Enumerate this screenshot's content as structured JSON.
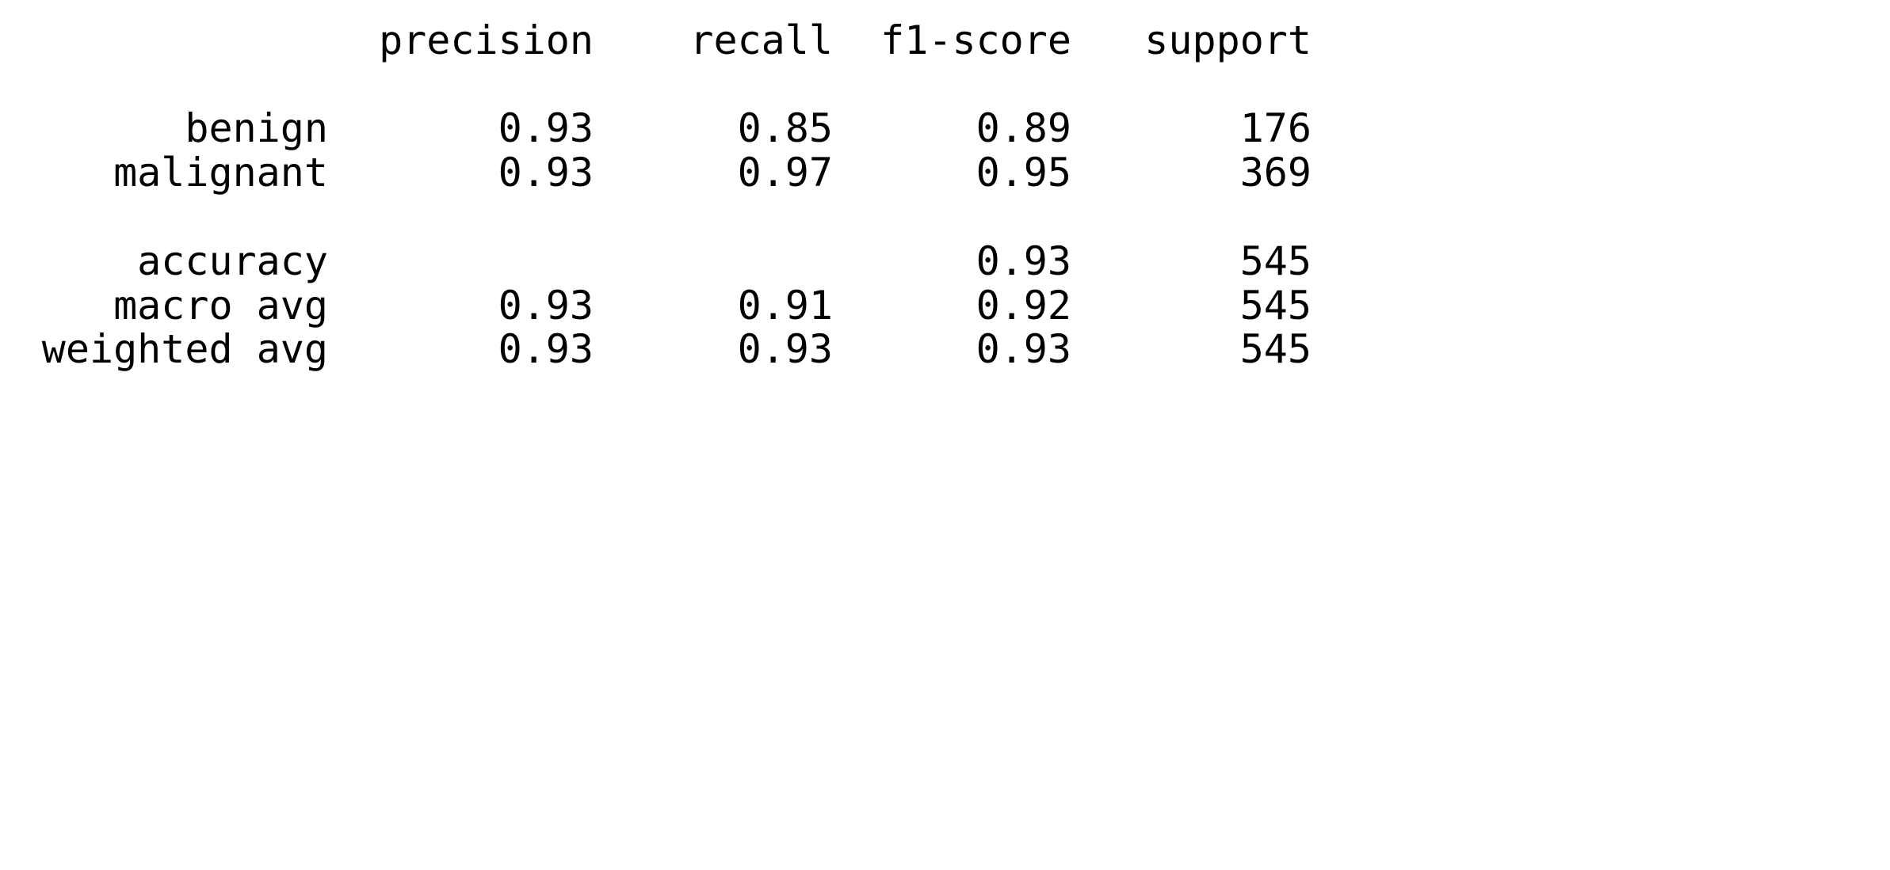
{
  "header": {
    "precision": "precision",
    "recall": "recall",
    "f1": "f1-score",
    "support": "support"
  },
  "rows": [
    {
      "label": "benign",
      "precision": "0.93",
      "recall": "0.85",
      "f1": "0.89",
      "support": "176"
    },
    {
      "label": "malignant",
      "precision": "0.93",
      "recall": "0.97",
      "f1": "0.95",
      "support": "369"
    },
    {
      "label": "accuracy",
      "precision": "",
      "recall": "",
      "f1": "0.93",
      "support": "545"
    },
    {
      "label": "macro avg",
      "precision": "0.93",
      "recall": "0.91",
      "f1": "0.92",
      "support": "545"
    },
    {
      "label": "weighted avg",
      "precision": "0.93",
      "recall": "0.93",
      "f1": "0.93",
      "support": "545"
    }
  ]
}
